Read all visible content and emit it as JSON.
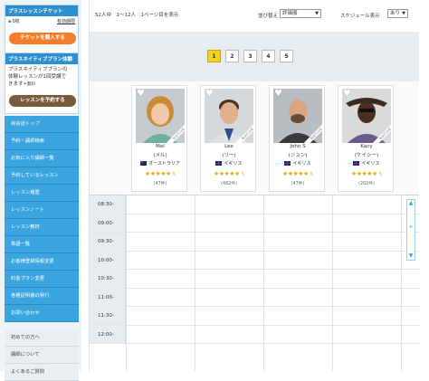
{
  "sidebar": {
    "ticket_title": "プラスレッスンチケット",
    "ticket_count": "0枚",
    "ticket_link": "有効期限",
    "buy_ticket_label": "チケットを購入する",
    "native_title": "プラスネイティブプラン体験",
    "native_text_1": "プラスネイティブプランの",
    "native_text_2": "体験レッスンが1回受講で",
    "native_text_3": "きます",
    "native_text_small": "＊無料",
    "book_lesson_label": "レッスンを予約する",
    "menu": [
      "英会話トップ",
      "予約・講師検索",
      "お気に入り講師一覧",
      "予約しているレッスン",
      "レッスン履歴",
      "レッスンノート",
      "レッスン教材",
      "単語一覧",
      "お客様登録情報変更",
      "料金プラン変更",
      "各種証明書の発行",
      "お問い合わせ"
    ],
    "menu2": [
      "初めての方へ",
      "講師について",
      "よくあるご質問"
    ]
  },
  "main": {
    "count_text": "52人中　1〜12人　1ページ目を表示",
    "sort_label": "並び替え",
    "sort_value": "評価順",
    "schedule_label": "スケジュール表示",
    "schedule_value": "あり",
    "pages": [
      "1",
      "2",
      "3",
      "4",
      "5"
    ],
    "active_page": "1",
    "native_badge": "NATIVE",
    "teachers": [
      {
        "name": "Mel",
        "kana": "(メル)",
        "country": "オーストラリア",
        "rating": "5",
        "reviews": "(47件)",
        "flag": "au"
      },
      {
        "name": "Lee",
        "kana": "(リー)",
        "country": "イギリス",
        "rating": "5",
        "reviews": "(482件)",
        "flag": "uk"
      },
      {
        "name": "John S",
        "kana": "(ジョン)",
        "country": "イギリス",
        "rating": "5",
        "reviews": "(47件)",
        "flag": "uk"
      },
      {
        "name": "Kacy",
        "kana": "(ケイシー)",
        "country": "イギリス",
        "rating": "5",
        "reviews": "(202件)",
        "flag": "uk"
      }
    ],
    "times": [
      "08:30-",
      "09:00-",
      "09:30-",
      "10:00-",
      "10:30-",
      "11:00-",
      "11:30-",
      "12:00-"
    ]
  },
  "colors": {
    "accent_blue": "#3ba5e0",
    "orange": "#f47d2b",
    "brown": "#7b5a3c",
    "page_active": "#f3d31b",
    "star": "#f0a30a"
  }
}
